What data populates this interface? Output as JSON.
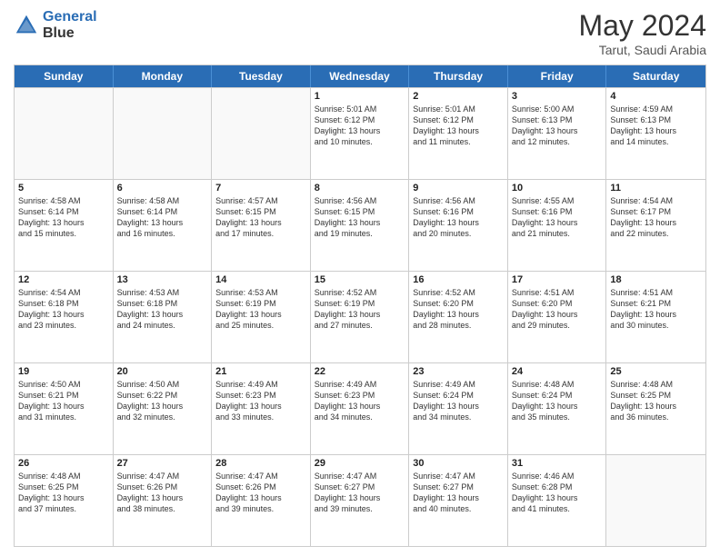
{
  "logo": {
    "line1": "General",
    "line2": "Blue"
  },
  "title": "May 2024",
  "subtitle": "Tarut, Saudi Arabia",
  "header": {
    "days": [
      "Sunday",
      "Monday",
      "Tuesday",
      "Wednesday",
      "Thursday",
      "Friday",
      "Saturday"
    ]
  },
  "weeks": [
    [
      {
        "day": "",
        "info": ""
      },
      {
        "day": "",
        "info": ""
      },
      {
        "day": "",
        "info": ""
      },
      {
        "day": "1",
        "info": "Sunrise: 5:01 AM\nSunset: 6:12 PM\nDaylight: 13 hours\nand 10 minutes."
      },
      {
        "day": "2",
        "info": "Sunrise: 5:01 AM\nSunset: 6:12 PM\nDaylight: 13 hours\nand 11 minutes."
      },
      {
        "day": "3",
        "info": "Sunrise: 5:00 AM\nSunset: 6:13 PM\nDaylight: 13 hours\nand 12 minutes."
      },
      {
        "day": "4",
        "info": "Sunrise: 4:59 AM\nSunset: 6:13 PM\nDaylight: 13 hours\nand 14 minutes."
      }
    ],
    [
      {
        "day": "5",
        "info": "Sunrise: 4:58 AM\nSunset: 6:14 PM\nDaylight: 13 hours\nand 15 minutes."
      },
      {
        "day": "6",
        "info": "Sunrise: 4:58 AM\nSunset: 6:14 PM\nDaylight: 13 hours\nand 16 minutes."
      },
      {
        "day": "7",
        "info": "Sunrise: 4:57 AM\nSunset: 6:15 PM\nDaylight: 13 hours\nand 17 minutes."
      },
      {
        "day": "8",
        "info": "Sunrise: 4:56 AM\nSunset: 6:15 PM\nDaylight: 13 hours\nand 19 minutes."
      },
      {
        "day": "9",
        "info": "Sunrise: 4:56 AM\nSunset: 6:16 PM\nDaylight: 13 hours\nand 20 minutes."
      },
      {
        "day": "10",
        "info": "Sunrise: 4:55 AM\nSunset: 6:16 PM\nDaylight: 13 hours\nand 21 minutes."
      },
      {
        "day": "11",
        "info": "Sunrise: 4:54 AM\nSunset: 6:17 PM\nDaylight: 13 hours\nand 22 minutes."
      }
    ],
    [
      {
        "day": "12",
        "info": "Sunrise: 4:54 AM\nSunset: 6:18 PM\nDaylight: 13 hours\nand 23 minutes."
      },
      {
        "day": "13",
        "info": "Sunrise: 4:53 AM\nSunset: 6:18 PM\nDaylight: 13 hours\nand 24 minutes."
      },
      {
        "day": "14",
        "info": "Sunrise: 4:53 AM\nSunset: 6:19 PM\nDaylight: 13 hours\nand 25 minutes."
      },
      {
        "day": "15",
        "info": "Sunrise: 4:52 AM\nSunset: 6:19 PM\nDaylight: 13 hours\nand 27 minutes."
      },
      {
        "day": "16",
        "info": "Sunrise: 4:52 AM\nSunset: 6:20 PM\nDaylight: 13 hours\nand 28 minutes."
      },
      {
        "day": "17",
        "info": "Sunrise: 4:51 AM\nSunset: 6:20 PM\nDaylight: 13 hours\nand 29 minutes."
      },
      {
        "day": "18",
        "info": "Sunrise: 4:51 AM\nSunset: 6:21 PM\nDaylight: 13 hours\nand 30 minutes."
      }
    ],
    [
      {
        "day": "19",
        "info": "Sunrise: 4:50 AM\nSunset: 6:21 PM\nDaylight: 13 hours\nand 31 minutes."
      },
      {
        "day": "20",
        "info": "Sunrise: 4:50 AM\nSunset: 6:22 PM\nDaylight: 13 hours\nand 32 minutes."
      },
      {
        "day": "21",
        "info": "Sunrise: 4:49 AM\nSunset: 6:23 PM\nDaylight: 13 hours\nand 33 minutes."
      },
      {
        "day": "22",
        "info": "Sunrise: 4:49 AM\nSunset: 6:23 PM\nDaylight: 13 hours\nand 34 minutes."
      },
      {
        "day": "23",
        "info": "Sunrise: 4:49 AM\nSunset: 6:24 PM\nDaylight: 13 hours\nand 34 minutes."
      },
      {
        "day": "24",
        "info": "Sunrise: 4:48 AM\nSunset: 6:24 PM\nDaylight: 13 hours\nand 35 minutes."
      },
      {
        "day": "25",
        "info": "Sunrise: 4:48 AM\nSunset: 6:25 PM\nDaylight: 13 hours\nand 36 minutes."
      }
    ],
    [
      {
        "day": "26",
        "info": "Sunrise: 4:48 AM\nSunset: 6:25 PM\nDaylight: 13 hours\nand 37 minutes."
      },
      {
        "day": "27",
        "info": "Sunrise: 4:47 AM\nSunset: 6:26 PM\nDaylight: 13 hours\nand 38 minutes."
      },
      {
        "day": "28",
        "info": "Sunrise: 4:47 AM\nSunset: 6:26 PM\nDaylight: 13 hours\nand 39 minutes."
      },
      {
        "day": "29",
        "info": "Sunrise: 4:47 AM\nSunset: 6:27 PM\nDaylight: 13 hours\nand 39 minutes."
      },
      {
        "day": "30",
        "info": "Sunrise: 4:47 AM\nSunset: 6:27 PM\nDaylight: 13 hours\nand 40 minutes."
      },
      {
        "day": "31",
        "info": "Sunrise: 4:46 AM\nSunset: 6:28 PM\nDaylight: 13 hours\nand 41 minutes."
      },
      {
        "day": "",
        "info": ""
      }
    ]
  ]
}
